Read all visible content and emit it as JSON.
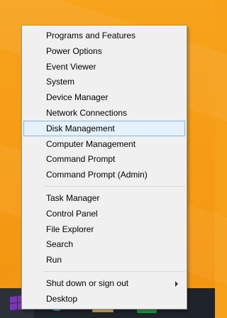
{
  "menu": {
    "groups": [
      {
        "items": [
          {
            "label": "Programs and Features"
          },
          {
            "label": "Power Options"
          },
          {
            "label": "Event Viewer"
          },
          {
            "label": "System"
          },
          {
            "label": "Device Manager"
          },
          {
            "label": "Network Connections"
          },
          {
            "label": "Disk Management",
            "selected": true
          },
          {
            "label": "Computer Management"
          },
          {
            "label": "Command Prompt"
          },
          {
            "label": "Command Prompt (Admin)"
          }
        ]
      },
      {
        "items": [
          {
            "label": "Task Manager"
          },
          {
            "label": "Control Panel"
          },
          {
            "label": "File Explorer"
          },
          {
            "label": "Search"
          },
          {
            "label": "Run"
          }
        ]
      },
      {
        "items": [
          {
            "label": "Shut down or sign out",
            "has_submenu": true
          },
          {
            "label": "Desktop"
          }
        ]
      }
    ]
  },
  "taskbar": {
    "items": [
      {
        "icon": "start-windows-logo-icon"
      },
      {
        "icon": "internet-explorer-icon"
      },
      {
        "icon": "file-explorer-icon"
      },
      {
        "icon": "windows-store-icon"
      }
    ]
  },
  "colors": {
    "desktop_background": "#f6a01a",
    "taskbar": "#1e2429",
    "start_logo": "#7d35b7",
    "menu_background": "#f0f0f0",
    "selection_fill": "#e5f1fb",
    "selection_border": "#86b7e3"
  }
}
